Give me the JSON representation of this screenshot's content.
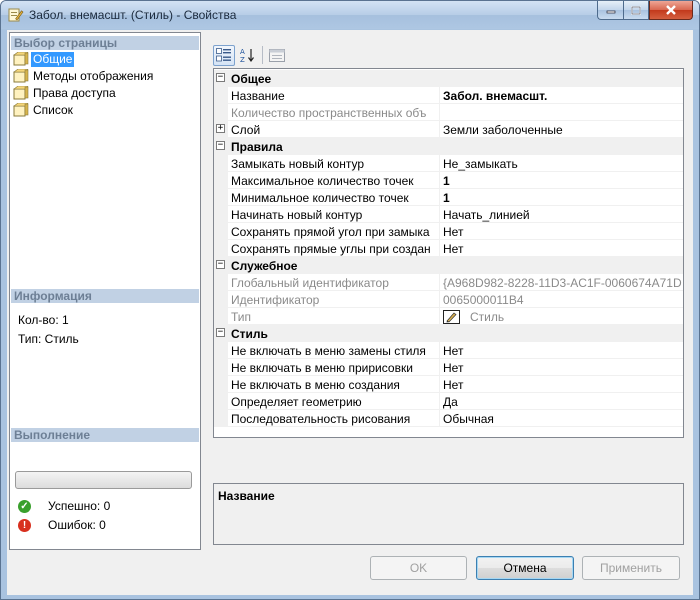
{
  "window": {
    "title": "Забол. внемасшт. (Стиль) - Свойства"
  },
  "left": {
    "page_select_header": "Выбор страницы",
    "pages": [
      {
        "label": "Общие",
        "selected": true
      },
      {
        "label": "Методы отображения",
        "selected": false
      },
      {
        "label": "Права доступа",
        "selected": false
      },
      {
        "label": "Список",
        "selected": false
      }
    ],
    "info_header": "Информация",
    "info": {
      "count": "Кол-во: 1",
      "type": "Тип: Стиль"
    },
    "exec_header": "Выполнение",
    "success": "Успешно: 0",
    "errors": "Ошибок: 0"
  },
  "grid": {
    "categories": [
      {
        "name": "Общее",
        "rows": [
          {
            "name": "Название",
            "value": "Забол. внемасшт.",
            "bold": true,
            "disabled": false,
            "expandable": false
          },
          {
            "name": "Количество пространственных объ",
            "value": "",
            "bold": false,
            "disabled": true,
            "expandable": false
          },
          {
            "name": "Слой",
            "value": "Земли заболоченные",
            "bold": false,
            "disabled": false,
            "expandable": true
          }
        ]
      },
      {
        "name": "Правила",
        "rows": [
          {
            "name": "Замыкать новый контур",
            "value": "Не_замыкать",
            "bold": false,
            "disabled": false,
            "expandable": false
          },
          {
            "name": "Максимальное количество точек",
            "value": "1",
            "bold": true,
            "disabled": false,
            "expandable": false
          },
          {
            "name": "Минимальное количество точек",
            "value": "1",
            "bold": true,
            "disabled": false,
            "expandable": false
          },
          {
            "name": "Начинать новый контур",
            "value": "Начать_линией",
            "bold": false,
            "disabled": false,
            "expandable": false
          },
          {
            "name": "Сохранять прямой угол при замыка",
            "value": "Нет",
            "bold": false,
            "disabled": false,
            "expandable": false
          },
          {
            "name": "Сохранять прямые углы при создан",
            "value": "Нет",
            "bold": false,
            "disabled": false,
            "expandable": false
          }
        ]
      },
      {
        "name": "Служебное",
        "rows": [
          {
            "name": "Глобальный идентификатор",
            "value": "{A968D982-8228-11D3-AC1F-0060674A71D",
            "bold": false,
            "disabled": true,
            "expandable": false
          },
          {
            "name": "Идентификатор",
            "value": "0065000011B4",
            "bold": false,
            "disabled": true,
            "expandable": false
          },
          {
            "name": "Тип",
            "value": "Стиль",
            "bold": false,
            "disabled": true,
            "expandable": false,
            "icon": "pencil-icon"
          }
        ]
      },
      {
        "name": "Стиль",
        "rows": [
          {
            "name": "Не включать в меню замены стиля",
            "value": "Нет",
            "bold": false,
            "disabled": false,
            "expandable": false
          },
          {
            "name": "Не включать в меню пририсовки",
            "value": "Нет",
            "bold": false,
            "disabled": false,
            "expandable": false
          },
          {
            "name": "Не включать в меню создания",
            "value": "Нет",
            "bold": false,
            "disabled": false,
            "expandable": false
          },
          {
            "name": "Определяет геометрию",
            "value": "Да",
            "bold": false,
            "disabled": false,
            "expandable": false
          },
          {
            "name": "Последовательность рисования",
            "value": "Обычная",
            "bold": false,
            "disabled": false,
            "expandable": false
          }
        ]
      }
    ]
  },
  "description": {
    "title": "Название"
  },
  "buttons": {
    "ok": "OK",
    "cancel": "Отмена",
    "apply": "Применить"
  },
  "colors": {
    "selection": "#3399ff",
    "section_header_bg": "#c1d1e4",
    "section_header_text": "#6d7f95",
    "success": "#3aa02d",
    "error": "#d8301e"
  }
}
